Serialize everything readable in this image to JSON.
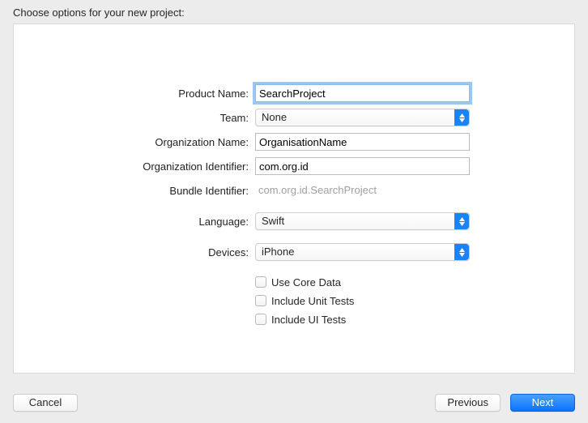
{
  "header": {
    "title": "Choose options for your new project:"
  },
  "form": {
    "product_name": {
      "label": "Product Name:",
      "value": "SearchProject"
    },
    "team": {
      "label": "Team:",
      "value": "None"
    },
    "org_name": {
      "label": "Organization Name:",
      "value": "OrganisationName"
    },
    "org_id": {
      "label": "Organization Identifier:",
      "value": "com.org.id"
    },
    "bundle_id": {
      "label": "Bundle Identifier:",
      "value": "com.org.id.SearchProject"
    },
    "language": {
      "label": "Language:",
      "value": "Swift"
    },
    "devices": {
      "label": "Devices:",
      "value": "iPhone"
    },
    "core_data": {
      "label": "Use Core Data",
      "checked": false
    },
    "unit_tests": {
      "label": "Include Unit Tests",
      "checked": false
    },
    "ui_tests": {
      "label": "Include UI Tests",
      "checked": false
    }
  },
  "footer": {
    "cancel": "Cancel",
    "previous": "Previous",
    "next": "Next"
  }
}
